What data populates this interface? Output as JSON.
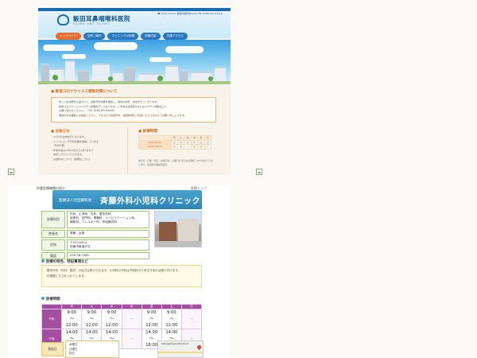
{
  "top_site": {
    "logo_jp": "飯田耳鼻咽喉科医院",
    "logo_en": "IIJIMA ENT CLINIC",
    "contact": "☎ ※※※-※※※※ 長野県飯田市※※※ TEL 0265-※※-※※※※",
    "nav": [
      "トップページ",
      "当院ご案内",
      "クリニックの特徴",
      "診療内容",
      "交通アクセス"
    ],
    "notice_title": "● 新型コロナウイルス感染対策について",
    "notice_lines": [
      "・新しい生活様式に基づいて、感染予防対策を徹底し、院内の換気・消毒を行っております。",
      "・新型コロナウイルスワクチン接種を行っております。ご予約は当院受付またはワクチン接種窓口へ",
      "　お問い合わせください。（TEL 0265-※※-※※※※）",
      "・発熱の方は事前にお電話ください。できるだけ電話予約・電話診療をご利用いただけますようお願い申し上げます。"
    ],
    "news_title": "● お知らせ",
    "news_lines": [
      "・11月3日は休診日となります。",
      "・インフルエンザ予防接種を開始しています",
      "　（予約不要）",
      "・年末年始は12月29日から1月3日まで",
      "　休診とさせていただきます。",
      "・お盆休みについて（詳細はこちら）"
    ],
    "hours_title": "● 診療時間",
    "hours_header": [
      "",
      "月",
      "火",
      "水",
      "木",
      "金",
      "土"
    ],
    "hours_rows": [
      [
        "9:00-12:30",
        "◎",
        "◎",
        "◎",
        "◎",
        "◎",
        "◎"
      ],
      [
        "15:00-18:30",
        "◎",
        "◎",
        "／",
        "◎",
        "◎",
        "／"
      ]
    ],
    "hours_note": "休診日：日曜・祝日・水曜午後・土曜午後 受付は診療終了30分前までとなります。飯田耳鼻咽喉科医院"
  },
  "bottom_site": {
    "site_name": "鈴鹿医療機関の紹介",
    "top_link": "医療トップ",
    "banner_sub": "医療法人社団藤和会",
    "banner_name": "斉藤外科小児科クリニック",
    "info": [
      {
        "label": "診療科目",
        "value": "外科、小児科、内科、整形外科、\n皮膚科、肛門科、胃腸科、リハビリテーション科、\n麻酔科、アレルギー科、呼吸器内科"
      },
      {
        "label": "院長名",
        "value": "斉藤　太郎"
      },
      {
        "label": "住所",
        "value": "〒513-0814\n鈴鹿市東旭が丘"
      },
      {
        "label": "電話",
        "value": "059-38-7985"
      }
    ],
    "notes_title": "診療の特色、特記事項など",
    "notes_lines": [
      "整形外科（外科・整形）の処方は受けられます。小児科の予約は予約枠のため空きあれば受け付けます。",
      "内視鏡にも力を入れています。"
    ],
    "hours_title": "診療時間",
    "hours_header": [
      "",
      "月",
      "火",
      "水",
      "木",
      "金",
      "土",
      "日"
    ],
    "hours_rows": [
      {
        "label": "午前",
        "cells": [
          "9:00\n〜\n12:00",
          "9:00\n〜\n12:00",
          "9:00\n〜\n12:00",
          "−",
          "9:00\n〜\n12:00",
          "9:00\n〜\n12:00",
          "−"
        ]
      },
      {
        "label": "午後",
        "cells": [
          "14:00\n〜\n18:00",
          "14:00\n〜\n18:00",
          "14:00\n〜\n18:00",
          "−",
          "14:00\n〜\n18:00",
          "14:00\n〜\n17:00",
          "−"
        ]
      }
    ],
    "closed_label": "休診日",
    "closed_lines": [
      "木曜日",
      "日曜日",
      "祝日"
    ],
    "map_label": "SaitogekiSyounika Clinic"
  }
}
